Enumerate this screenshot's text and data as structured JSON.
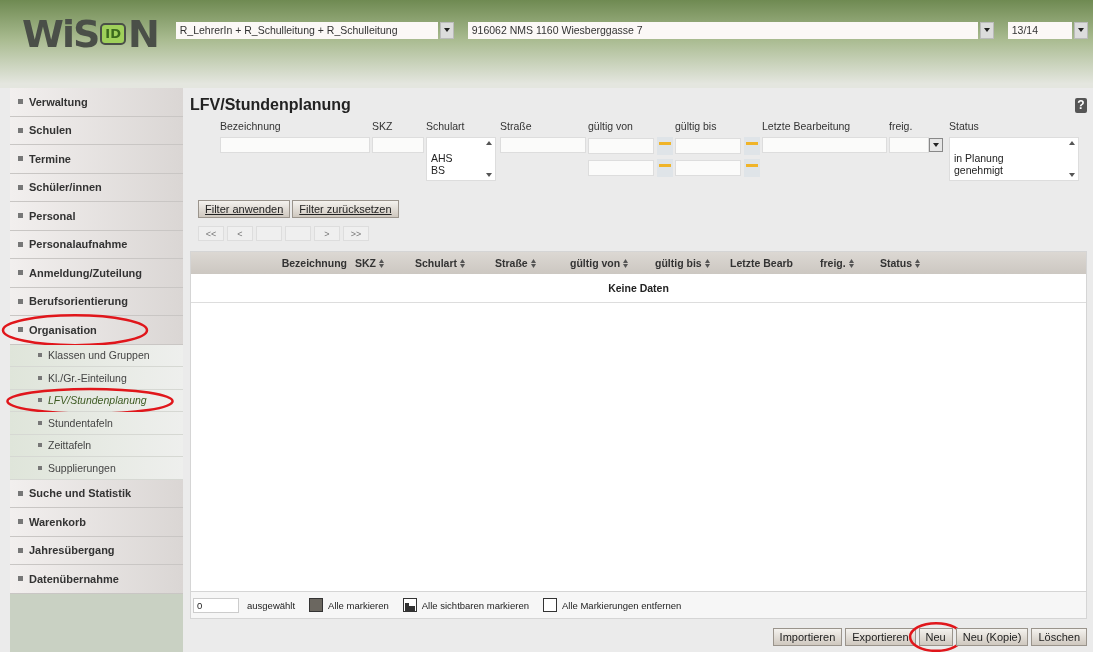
{
  "header": {
    "logo": {
      "text": "WiS",
      "badge": "ID",
      "suffix": "N"
    },
    "selects": [
      {
        "value": "R_LehrerIn + R_Schulleitung + R_Schulleitung"
      },
      {
        "value": "916062 NMS 1160 Wiesberggasse 7"
      },
      {
        "value": "13/14"
      }
    ]
  },
  "sidebar": {
    "items": [
      {
        "label": "Verwaltung",
        "selected": false,
        "highlighted": false
      },
      {
        "label": "Schulen",
        "selected": false,
        "highlighted": false
      },
      {
        "label": "Termine",
        "selected": false,
        "highlighted": false
      },
      {
        "label": "Schüler/innen",
        "selected": false,
        "highlighted": false
      },
      {
        "label": "Personal",
        "selected": false,
        "highlighted": false
      },
      {
        "label": "Personalaufnahme",
        "selected": false,
        "highlighted": false
      },
      {
        "label": "Anmeldung/Zuteilung",
        "selected": false,
        "highlighted": false
      },
      {
        "label": "Berufsorientierung",
        "selected": false,
        "highlighted": false
      },
      {
        "label": "Organisation",
        "selected": false,
        "highlighted": true,
        "expanded": true,
        "children": [
          {
            "label": "Klassen und Gruppen",
            "selected": false,
            "highlighted": false
          },
          {
            "label": "Kl./Gr.-Einteilung",
            "selected": false,
            "highlighted": false
          },
          {
            "label": "LFV/Stundenplanung",
            "selected": true,
            "highlighted": true
          },
          {
            "label": "Stundentafeln",
            "selected": false,
            "highlighted": false
          },
          {
            "label": "Zeittafeln",
            "selected": false,
            "highlighted": false
          },
          {
            "label": "Supplierungen",
            "selected": false,
            "highlighted": false
          }
        ]
      },
      {
        "label": "Suche und Statistik",
        "selected": false,
        "highlighted": false
      },
      {
        "label": "Warenkorb",
        "selected": false,
        "highlighted": false
      },
      {
        "label": "Jahresübergang",
        "selected": false,
        "highlighted": false
      },
      {
        "label": "Datenübernahme",
        "selected": false,
        "highlighted": false
      }
    ]
  },
  "page": {
    "title": "LFV/Stundenplanung",
    "help": "?"
  },
  "filters": [
    {
      "label": "Bezeichnung",
      "kind": "text"
    },
    {
      "label": "SKZ",
      "kind": "text"
    },
    {
      "label": "Schulart",
      "kind": "list",
      "options": [
        "AHS",
        "BS"
      ]
    },
    {
      "label": "Straße",
      "kind": "text"
    },
    {
      "label": "gültig von",
      "kind": "date"
    },
    {
      "label": "gültig bis",
      "kind": "date"
    },
    {
      "label": "Letzte Bearbeitung",
      "kind": "text"
    },
    {
      "label": "freig.",
      "kind": "select"
    },
    {
      "label": "Status",
      "kind": "list",
      "options": [
        "in Planung",
        "genehmigt"
      ]
    }
  ],
  "filter_buttons": [
    "Filter anwenden",
    "Filter zurücksetzen"
  ],
  "pager": [
    {
      "label": "<<",
      "disabled": true
    },
    {
      "label": "<",
      "disabled": true
    },
    {
      "disabled": true
    },
    {
      "disabled": true
    },
    {
      "label": ">",
      "disabled": true
    },
    {
      "label": ">>",
      "disabled": true
    }
  ],
  "table": {
    "columns": [
      {
        "label": "Bezeichnung",
        "sortable": false
      },
      {
        "label": "SKZ",
        "sortable": true
      },
      {
        "label": "Schulart",
        "sortable": true
      },
      {
        "label": "Straße",
        "sortable": true
      },
      {
        "label": "gültig von",
        "sortable": true
      },
      {
        "label": "gültig bis",
        "sortable": true
      },
      {
        "label": "Letzte Bearb",
        "sortable": false
      },
      {
        "label": "freig.",
        "sortable": true
      },
      {
        "label": "Status",
        "sortable": true
      }
    ],
    "empty_message": "Keine Daten"
  },
  "selection": {
    "count": "0",
    "count_label": "ausgewählt",
    "actions": [
      {
        "label": "Alle markieren",
        "kind": "all"
      },
      {
        "label": "Alle sichtbaren markieren",
        "kind": "visible"
      },
      {
        "label": "Alle Markierungen entfernen",
        "kind": "none"
      }
    ]
  },
  "actions": [
    {
      "label": "Importieren",
      "highlighted": false
    },
    {
      "label": "Exportieren",
      "highlighted": false
    },
    {
      "label": "Neu",
      "highlighted": true
    },
    {
      "label": "Neu (Kopie)",
      "highlighted": false
    },
    {
      "label": "Löschen",
      "highlighted": false
    }
  ]
}
